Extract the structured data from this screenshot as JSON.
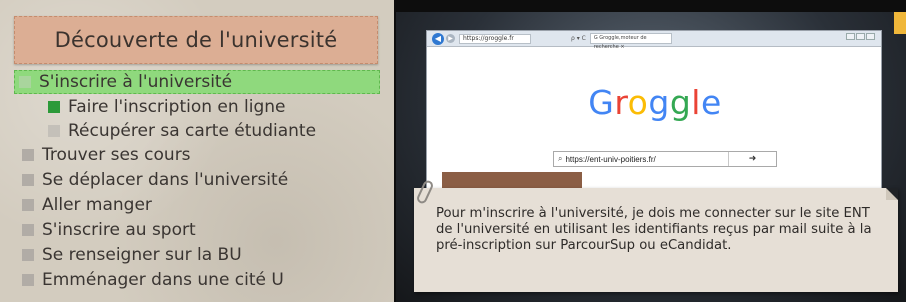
{
  "sidebar": {
    "title": "Découverte de l'université",
    "items": [
      {
        "label": "S'inscrire à l'université",
        "level": 0,
        "active": true
      },
      {
        "label": "Faire l'inscription en ligne",
        "level": 1,
        "status": "current"
      },
      {
        "label": "Récupérer sa carte étudiante",
        "level": 1,
        "status": "pending"
      },
      {
        "label": "Trouver ses cours",
        "level": 0
      },
      {
        "label": "Se déplacer dans l'université",
        "level": 0
      },
      {
        "label": "Aller manger",
        "level": 0
      },
      {
        "label": "S'inscrire au sport",
        "level": 0
      },
      {
        "label": "Se renseigner sur la BU",
        "level": 0
      },
      {
        "label": "Emménager dans une cité U",
        "level": 0
      }
    ]
  },
  "browser": {
    "url": "https://groggle.fr",
    "search_mini": "ρ ▾ C",
    "tab_label": "G Groggle,moteur de recherche ×",
    "logo_letters": [
      "G",
      "r",
      "o",
      "g",
      "g",
      "l",
      "e"
    ],
    "search_value": "https://ent-univ-poitiers.fr/",
    "go_glyph": "➜"
  },
  "note": {
    "text": "Pour m'inscrire à l'université, je dois me connecter sur le site ENT de l'université en utilisant les identifiants reçus par mail suite à la pré-inscription sur ParcourSup ou eCandidat."
  },
  "colors": {
    "active_item_bg": "#8fd97d",
    "current_square": "#2c9a39",
    "title_box_bg": "#dcae94",
    "logo": [
      "#4285f4",
      "#ea4335",
      "#fbbc05",
      "#4285f4",
      "#34a853",
      "#ea4335",
      "#4285f4"
    ]
  }
}
